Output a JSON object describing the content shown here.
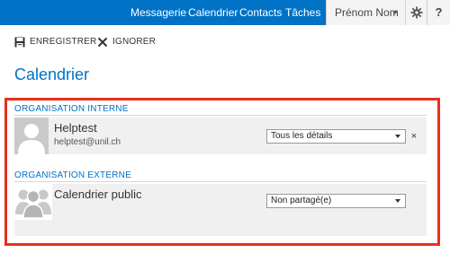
{
  "nav": {
    "items": [
      {
        "label": "Messagerie",
        "active": false
      },
      {
        "label": "Calendrier",
        "active": true
      },
      {
        "label": "Contacts",
        "active": false
      },
      {
        "label": "Tâches",
        "active": false
      }
    ],
    "user_name": "Prénom Nom",
    "settings_icon": "gear-icon",
    "help_icon": "question-icon"
  },
  "toolbar": {
    "save_label": "ENREGISTRER",
    "save_icon": "floppy-disk-icon",
    "discard_label": "IGNORER",
    "discard_icon": "x-icon"
  },
  "page": {
    "title": "Calendrier"
  },
  "sections": {
    "internal": {
      "header": "ORGANISATION INTERNE",
      "entries": [
        {
          "name": "Helptest",
          "email": "helptest@unil.ch",
          "permission": "Tous les détails"
        }
      ]
    },
    "external": {
      "header": "ORGANISATION EXTERNE",
      "entries": [
        {
          "name": "Calendrier public",
          "permission": "Non partagé(e)"
        }
      ]
    }
  },
  "colors": {
    "accent": "#0072c6",
    "highlight_border": "#e8301c",
    "row_bg": "#f0f0f0"
  }
}
